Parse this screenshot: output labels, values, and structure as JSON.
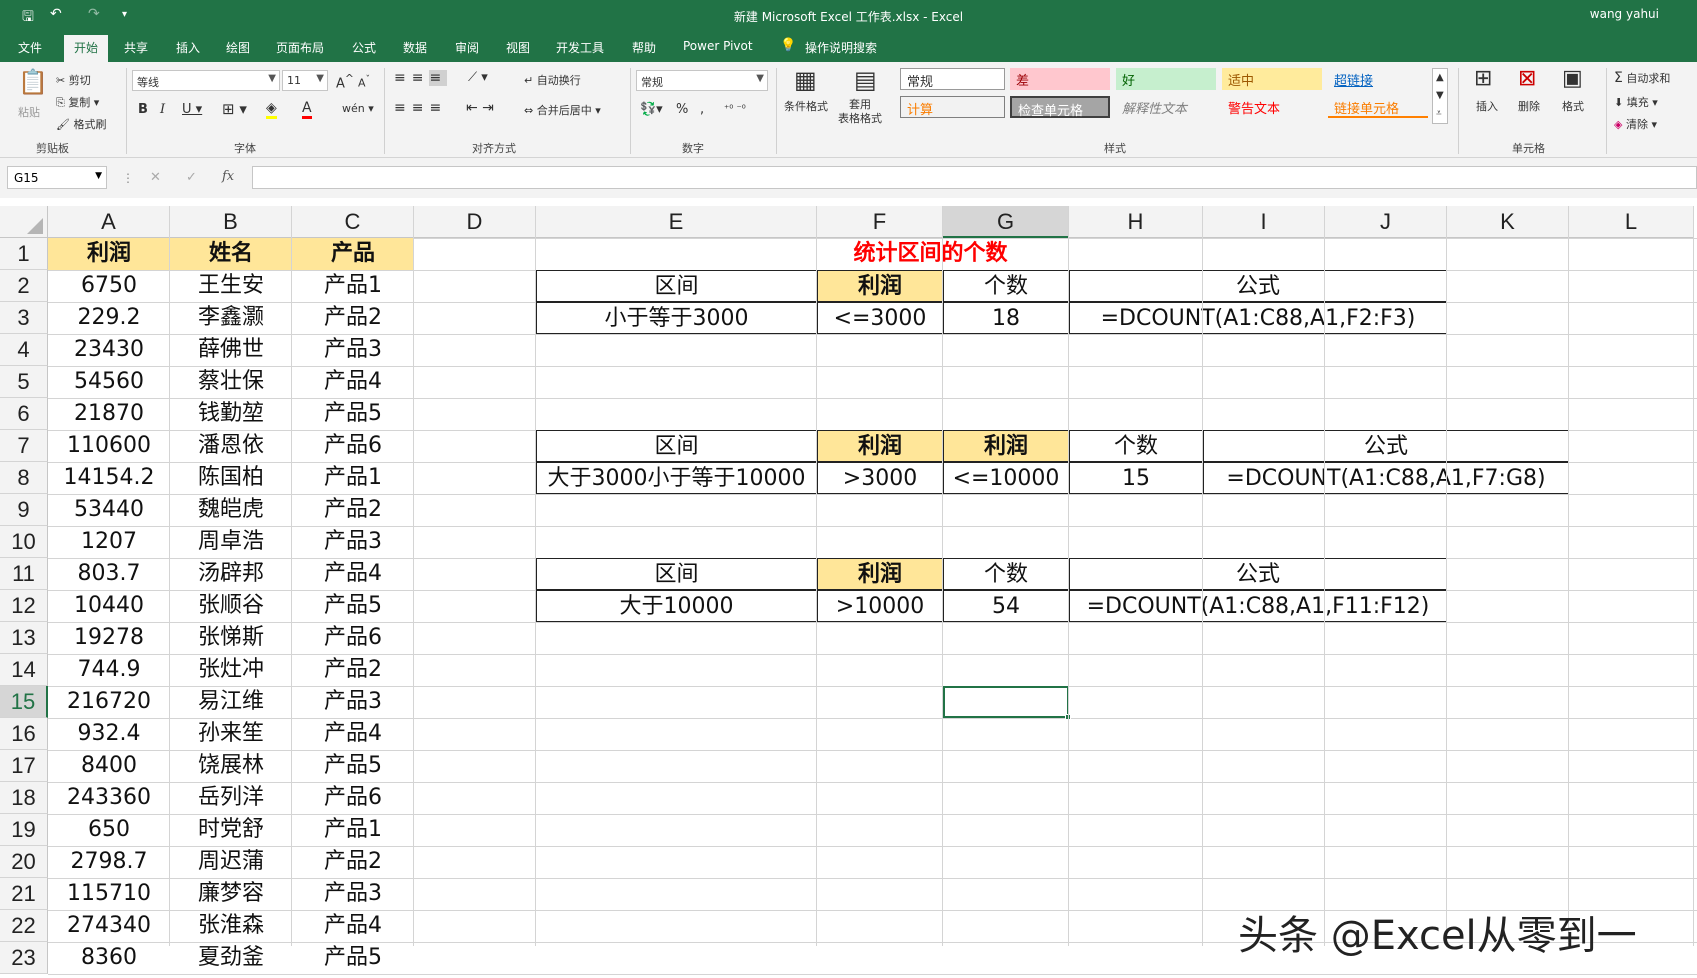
{
  "title_bar": {
    "title": "新建 Microsoft Excel 工作表.xlsx  -  Excel",
    "user": "wang yahui"
  },
  "tabs": [
    "文件",
    "开始",
    "共享",
    "插入",
    "绘图",
    "页面布局",
    "公式",
    "数据",
    "审阅",
    "视图",
    "开发工具",
    "帮助",
    "Power Pivot",
    "操作说明搜索"
  ],
  "ribbon": {
    "clipboard": {
      "paste": "粘贴",
      "cut": "剪切",
      "copy": "复制",
      "format_painter": "格式刷",
      "group": "剪贴板"
    },
    "font": {
      "name": "等线",
      "size": "11",
      "group": "字体"
    },
    "alignment": {
      "wrap": "自动换行",
      "merge": "合并后居中",
      "group": "对齐方式"
    },
    "number": {
      "format": "常规",
      "group": "数字"
    },
    "styles": {
      "conditional": "条件格式",
      "table": "套用\n表格格式",
      "normal": "常规",
      "bad": "差",
      "good": "好",
      "neutral": "适中",
      "hyperlink": "超链接",
      "calc": "计算",
      "check": "检查单元格",
      "explain": "解释性文本",
      "warning": "警告文本",
      "linked": "链接单元格",
      "group": "样式"
    },
    "cells": {
      "insert": "插入",
      "delete": "删除",
      "format": "格式",
      "group": "单元格"
    },
    "editing": {
      "autosum": "自动求和",
      "fill": "填充",
      "clear": "清除"
    }
  },
  "formula_bar": {
    "name_box": "G15",
    "fx": "fx",
    "value": ""
  },
  "columns": [
    "A",
    "B",
    "C",
    "D",
    "E",
    "F",
    "G",
    "H",
    "I",
    "J",
    "K",
    "L"
  ],
  "rows": [
    "1",
    "2",
    "3",
    "4",
    "5",
    "6",
    "7",
    "8",
    "9",
    "10",
    "11",
    "12",
    "13",
    "14",
    "15",
    "16",
    "17",
    "18",
    "19",
    "20",
    "21",
    "22",
    "23"
  ],
  "data_headers": [
    "利润",
    "姓名",
    "产品"
  ],
  "data_rows": [
    [
      "6750",
      "王生安",
      "产品1"
    ],
    [
      "229.2",
      "李鑫灏",
      "产品2"
    ],
    [
      "23430",
      "薛佛世",
      "产品3"
    ],
    [
      "54560",
      "蔡壮保",
      "产品4"
    ],
    [
      "21870",
      "钱勤堃",
      "产品5"
    ],
    [
      "110600",
      "潘恩依",
      "产品6"
    ],
    [
      "14154.2",
      "陈国柏",
      "产品1"
    ],
    [
      "53440",
      "魏皑虎",
      "产品2"
    ],
    [
      "1207",
      "周卓浩",
      "产品3"
    ],
    [
      "803.7",
      "汤辟邦",
      "产品4"
    ],
    [
      "10440",
      "张顺谷",
      "产品5"
    ],
    [
      "19278",
      "张悌斯",
      "产品6"
    ],
    [
      "744.9",
      "张灶冲",
      "产品2"
    ],
    [
      "216720",
      "易江维",
      "产品3"
    ],
    [
      "932.4",
      "孙来笙",
      "产品4"
    ],
    [
      "8400",
      "饶展林",
      "产品5"
    ],
    [
      "243360",
      "岳列洋",
      "产品6"
    ],
    [
      "650",
      "时党舒",
      "产品1"
    ],
    [
      "2798.7",
      "周迟蒲",
      "产品2"
    ],
    [
      "115710",
      "廉梦容",
      "产品3"
    ],
    [
      "274340",
      "张淮森",
      "产品4"
    ],
    [
      "8360",
      "夏劲釜",
      "产品5"
    ]
  ],
  "sheet_title": "统计区间的个数",
  "table1": {
    "h_range": "区间",
    "h_profit": "利润",
    "h_count": "个数",
    "h_formula": "公式",
    "range": "小于等于3000",
    "cond": "<=3000",
    "count": "18",
    "formula": "=DCOUNT(A1:C88,A1,F2:F3)"
  },
  "table2": {
    "h_range": "区间",
    "h_profit1": "利润",
    "h_profit2": "利润",
    "h_count": "个数",
    "h_formula": "公式",
    "range": "大于3000小于等于10000",
    "cond1": ">3000",
    "cond2": "<=10000",
    "count": "15",
    "formula": "=DCOUNT(A1:C88,A1,F7:G8)"
  },
  "table3": {
    "h_range": "区间",
    "h_profit": "利润",
    "h_count": "个数",
    "h_formula": "公式",
    "range": "大于10000",
    "cond": ">10000",
    "count": "54",
    "formula": "=DCOUNT(A1:C88,A1,F11:F12)"
  },
  "watermark": "头条 @Excel从零到一",
  "colors": {
    "excel_green": "#217346",
    "header_fill": "#ffe699",
    "title_red": "#ff0000"
  }
}
